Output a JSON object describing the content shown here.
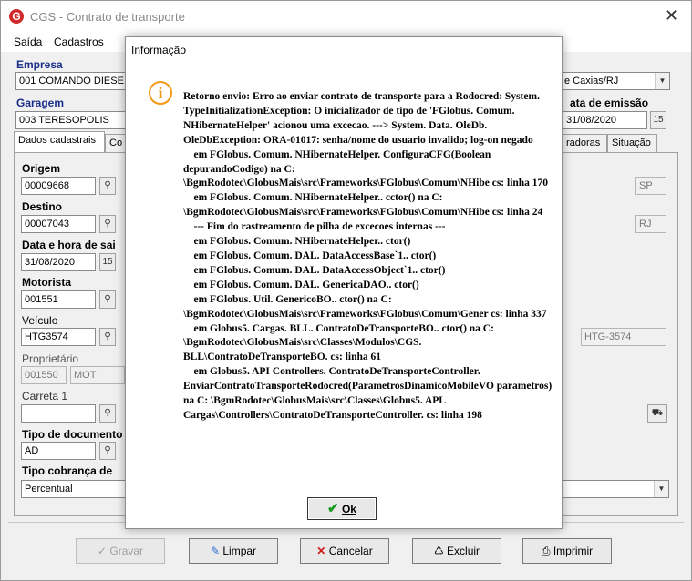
{
  "window": {
    "title": "CGS - Contrato de transporte"
  },
  "menu": [
    "Saída",
    "Cadastros"
  ],
  "form": {
    "empresa_label": "Empresa",
    "empresa_value": "001 COMANDO DIESE",
    "cidade_value": "e Caxias/RJ",
    "garagem_label": "Garagem",
    "garagem_value": "003 TERESOPOLIS",
    "data_emissao_label": "ata de emissão",
    "data_emissao_value": "31/08/2020",
    "tabs": [
      "Dados cadastrais",
      "Co",
      "radoras",
      "Situação"
    ],
    "origem_label": "Origem",
    "origem_value": "00009668",
    "origem_uf": "SP",
    "destino_label": "Destino",
    "destino_value": "00007043",
    "destino_uf": "RJ",
    "data_saida_label": "Data e hora de sai",
    "data_saida_value": "31/08/2020",
    "motorista_label": "Motorista",
    "motorista_value": "001551",
    "veiculo_label": "Veículo",
    "veiculo_value": "HTG3574",
    "veiculo_placa": "HTG-3574",
    "proprietario_label": "Proprietário",
    "proprietario_value": "001550",
    "proprietario_nome": "MOT",
    "carreta_label": "Carreta 1",
    "tipo_doc_label": "Tipo de documento",
    "tipo_doc_value": "AD",
    "tipo_cobranca_label": "Tipo cobrança de",
    "tipo_cobranca_value": "Percentual"
  },
  "buttons": {
    "gravar": "Gravar",
    "limpar": "Limpar",
    "cancelar": "Cancelar",
    "excluir": "Excluir",
    "imprimir": "Imprimir"
  },
  "dialog": {
    "title": "Informação",
    "ok": "Ok",
    "message": "Retorno envio: Erro ao enviar contrato de transporte para a Rodocred: System. TypeInitializationException: O inicializador de tipo de 'FGlobus. Comum. NHibernateHelper' acionou uma excecao. ---> System. Data. OleDb. OleDbException: ORA-01017: senha/nome do usuario invalido; log-on negado\n    em FGlobus. Comum. NHibernateHelper. ConfiguraCFG(Boolean depurandoCodigo) na C: \\BgmRodotec\\GlobusMais\\src\\Frameworks\\FGlobus\\Comum\\NHibe cs: linha 170\n    em FGlobus. Comum. NHibernateHelper.. cctor() na C: \\BgmRodotec\\GlobusMais\\src\\Frameworks\\FGlobus\\Comum\\NHibe cs: linha 24\n    --- Fim do rastreamento de pilha de excecoes internas ---\n    em FGlobus. Comum. NHibernateHelper.. ctor()\n    em FGlobus. Comum. DAL. DataAccessBase`1.. ctor()\n    em FGlobus. Comum. DAL. DataAccessObject`1.. ctor()\n    em FGlobus. Comum. DAL. GenericaDAO.. ctor()\n    em FGlobus. Util. GenericoBO.. ctor() na C: \\BgmRodotec\\GlobusMais\\src\\Frameworks\\FGlobus\\Comum\\Gener cs: linha 337\n    em Globus5. Cargas. BLL. ContratoDeTransporteBO.. ctor() na C: \\BgmRodotec\\GlobusMais\\src\\Classes\\Modulos\\CGS. BLL\\ContratoDeTransporteBO. cs: linha 61\n    em Globus5. API Controllers. ContratoDeTransporteController. EnviarContratoTransporteRodocred(ParametrosDinamicoMobileVO parametros) na C: \\BgmRodotec\\GlobusMais\\src\\Classes\\Globus5. APL Cargas\\Controllers\\ContratoDeTransporteController. cs: linha 198"
  }
}
